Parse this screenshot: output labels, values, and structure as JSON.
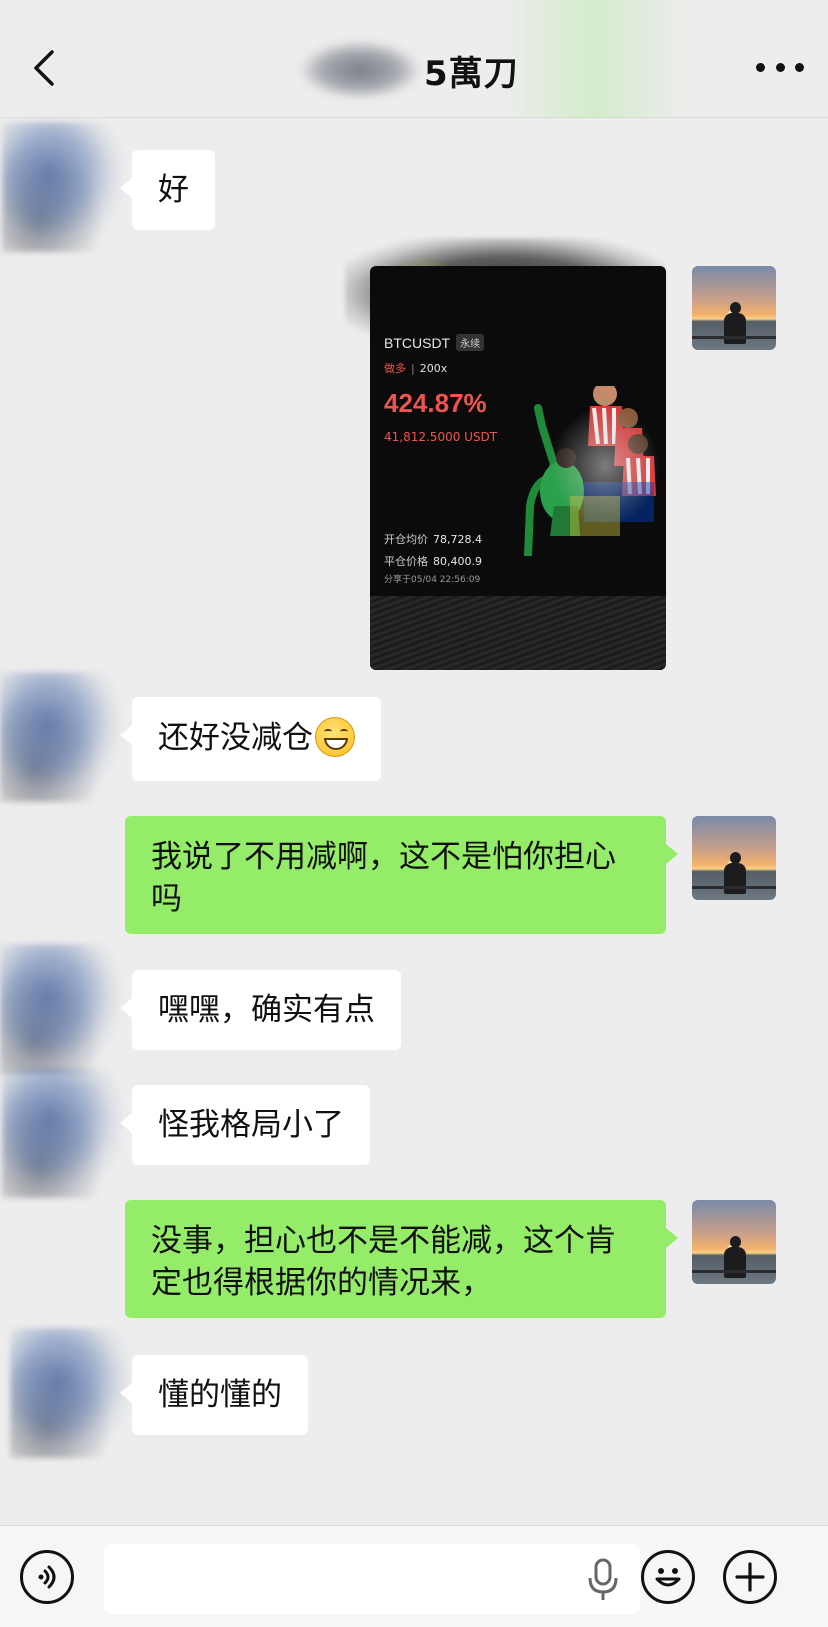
{
  "header": {
    "title": "5萬刀"
  },
  "messages": [
    {
      "from": "contact",
      "text": "好"
    },
    {
      "from": "me",
      "type": "image"
    },
    {
      "from": "contact",
      "text": "还好没减仓",
      "emoji": "grinning-face-emoji"
    },
    {
      "from": "me",
      "text": "我说了不用减啊，这不是怕你担心吗"
    },
    {
      "from": "contact",
      "text": "嘿嘿，确实有点"
    },
    {
      "from": "contact",
      "text": "怪我格局小了"
    },
    {
      "from": "me",
      "text": "没事，担心也不是不能减，这个肯定也得根据你的情况来，"
    },
    {
      "from": "contact",
      "text": "懂的懂的"
    }
  ],
  "trade_card": {
    "pair": "BTCUSDT",
    "contract_type": "永续",
    "side": "做多",
    "leverage": "200x",
    "pnl_percent": "424.87%",
    "pnl_amount": "41,812.5000 USDT",
    "entry_label": "开仓均价",
    "entry_value": "78,728.4",
    "exit_label": "平仓价格",
    "exit_value": "80,400.9",
    "shared_at": "分享于05/04 22:56:09"
  },
  "colors": {
    "background": "#ededed",
    "bubble_in": "#ffffff",
    "bubble_out": "#95ec69",
    "profit_red": "#f0544f"
  },
  "icons": {
    "back": "chevron-left-icon",
    "more": "more-dots-icon",
    "voice": "voice-icon",
    "mic": "mic-icon",
    "emoji": "emoji-icon",
    "add": "plus-icon"
  }
}
